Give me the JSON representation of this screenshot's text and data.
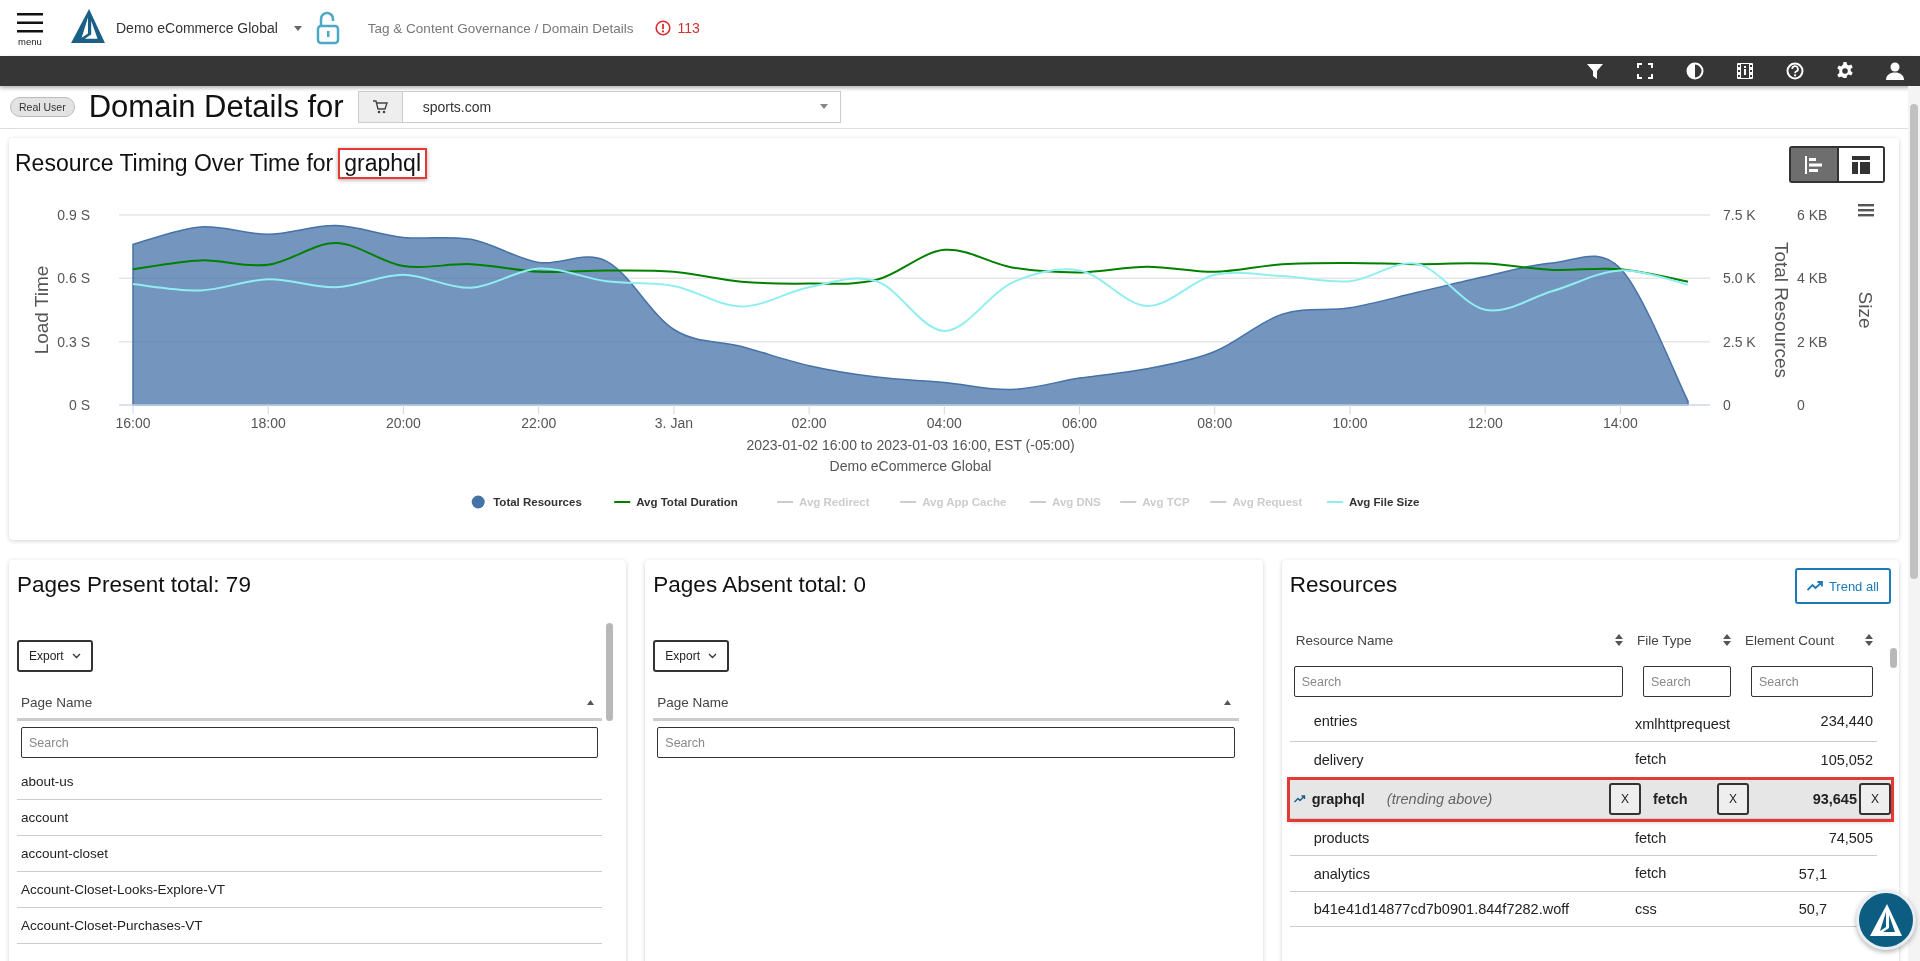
{
  "header": {
    "menu_label": "menu",
    "account": "Demo eCommerce Global",
    "breadcrumb": "Tag & Content Governance / Domain Details",
    "alert_count": "113"
  },
  "page": {
    "badge": "Real User",
    "title": "Domain Details for",
    "domain": "sports.com"
  },
  "chart_card": {
    "title": "Resource Timing Over Time for",
    "subject": "graphql",
    "subject_marked": true,
    "views": [
      {
        "kind": "chart",
        "selected": true
      },
      {
        "kind": "layout",
        "selected": false
      }
    ],
    "caption": [
      "2023-01-02 16:00 to 2023-01-03 16:00, EST (-05:00)",
      "Demo eCommerce Global"
    ],
    "chart_data": {
      "type": "line",
      "legend": "bottom",
      "ylabel": "Load Time",
      "ylim": [
        0,
        0.9
      ],
      "yticks": [
        {
          "value": 0,
          "label": "0 S"
        },
        {
          "value": 0.3,
          "label": "0.3 S"
        },
        {
          "value": 0.6,
          "label": "0.6 S"
        },
        {
          "value": 0.9,
          "label": "0.9 S"
        }
      ],
      "y2label": "Total Resources",
      "y2lim": [
        0,
        7500
      ],
      "y2ticks": [
        {
          "value": 0,
          "label": "0"
        },
        {
          "value": 2500,
          "label": "2.5 K"
        },
        {
          "value": 5000,
          "label": "5.0 K"
        },
        {
          "value": 7500,
          "label": "7.5 K"
        }
      ],
      "y3label": "Size",
      "y3lim": [
        0,
        6
      ],
      "y3ticks": [
        {
          "value": 0,
          "label": "0"
        },
        {
          "value": 2,
          "label": "2 KB"
        },
        {
          "value": 4,
          "label": "4 KB"
        },
        {
          "value": 6,
          "label": "6 KB"
        }
      ],
      "categories": [
        "16:00",
        null,
        "18:00",
        null,
        "20:00",
        null,
        "22:00",
        null,
        "3. Jan",
        null,
        "02:00",
        null,
        "04:00",
        null,
        "06:00",
        null,
        "08:00",
        null,
        "10:00",
        null,
        "12:00",
        null,
        "14:00",
        null
      ],
      "series": [
        {
          "name": "Total Resources",
          "type": "area",
          "axis": "y2",
          "color": "#4572a7",
          "values": [
            6340,
            7030,
            6740,
            7080,
            6610,
            6540,
            5630,
            5680,
            2980,
            2310,
            1550,
            1100,
            890,
            610,
            1060,
            1430,
            2110,
            3590,
            3840,
            4450,
            5070,
            5610,
            5390,
            150
          ]
        },
        {
          "name": "Avg Total Duration",
          "color": "#008000",
          "values": [
            0.643,
            0.685,
            0.664,
            0.767,
            0.658,
            0.667,
            0.631,
            0.637,
            0.631,
            0.584,
            0.575,
            0.593,
            0.735,
            0.652,
            0.628,
            0.655,
            0.631,
            0.667,
            0.673,
            0.667,
            0.67,
            0.64,
            0.643,
            0.584
          ]
        },
        {
          "name": "Avg Redirect",
          "color": "#cccccc",
          "values": [
            null,
            null,
            null,
            null,
            null,
            null,
            null,
            null,
            null,
            null,
            null,
            null,
            null,
            null,
            null,
            null,
            null,
            null,
            null,
            null,
            null,
            null,
            null,
            null
          ]
        },
        {
          "name": "Avg App Cache",
          "color": "#cccccc",
          "values": [
            null,
            null,
            null,
            null,
            null,
            null,
            null,
            null,
            null,
            null,
            null,
            null,
            null,
            null,
            null,
            null,
            null,
            null,
            null,
            null,
            null,
            null,
            null,
            null
          ]
        },
        {
          "name": "Avg DNS",
          "color": "#cccccc",
          "values": [
            null,
            null,
            null,
            null,
            null,
            null,
            null,
            null,
            null,
            null,
            null,
            null,
            null,
            null,
            null,
            null,
            null,
            null,
            null,
            null,
            null,
            null,
            null,
            null
          ]
        },
        {
          "name": "Avg TCP",
          "color": "#cccccc",
          "values": [
            null,
            null,
            null,
            null,
            null,
            null,
            null,
            null,
            null,
            null,
            null,
            null,
            null,
            null,
            null,
            null,
            null,
            null,
            null,
            null,
            null,
            null,
            null,
            null
          ]
        },
        {
          "name": "Avg Request",
          "color": "#cccccc",
          "values": [
            null,
            null,
            null,
            null,
            null,
            null,
            null,
            null,
            null,
            null,
            null,
            null,
            null,
            null,
            null,
            null,
            null,
            null,
            null,
            null,
            null,
            null,
            null,
            null
          ]
        },
        {
          "name": "Avg File Size",
          "axis": "y3",
          "color": "#90eef0",
          "values": [
            3.82,
            3.62,
            3.97,
            3.72,
            4.11,
            3.7,
            4.31,
            3.91,
            3.76,
            3.11,
            3.72,
            3.91,
            2.34,
            3.86,
            4.25,
            3.13,
            4.11,
            4.07,
            3.91,
            4.45,
            3.01,
            3.6,
            4.25,
            3.8
          ]
        }
      ]
    }
  },
  "pages_present": {
    "title": "Pages Present total: 79",
    "export": "Export",
    "column": "Page Name",
    "placeholder": "Search",
    "rows": [
      "about-us",
      "account",
      "account-closet",
      "Account-Closet-Looks-Explore-VT",
      "Account-Closet-Purchases-VT"
    ]
  },
  "pages_absent": {
    "title": "Pages Absent total: 0",
    "export": "Export",
    "column": "Page Name",
    "placeholder": "Search"
  },
  "resources": {
    "title": "Resources",
    "trend_button": "Trend all",
    "columns": [
      {
        "label": "Resource Name",
        "placeholder": "Search"
      },
      {
        "label": "File Type",
        "placeholder": "Search"
      },
      {
        "label": "Element Count",
        "placeholder": "Search"
      }
    ],
    "rows": [
      {
        "name": "entries",
        "file_type": "xmlhttprequest",
        "count": "234,440",
        "selected": false
      },
      {
        "name": "delivery",
        "file_type": "fetch",
        "count": "105,052",
        "selected": false
      },
      {
        "name": "graphql",
        "note": "(trending above)",
        "trending": true,
        "file_type": "fetch",
        "count": "93,645",
        "selected": true,
        "clear_buttons": [
          "X",
          "X",
          "X"
        ]
      },
      {
        "name": "products",
        "file_type": "fetch",
        "count": "74,505",
        "selected": false
      },
      {
        "name": "analytics",
        "file_type": "fetch",
        "count": "57,1",
        "selected": false,
        "cut_off": true
      },
      {
        "name": "b41e41d14877cd7b0901.844f7282.woff",
        "file_type": "css",
        "count": "50,7",
        "selected": false,
        "cut_off": true
      }
    ]
  }
}
